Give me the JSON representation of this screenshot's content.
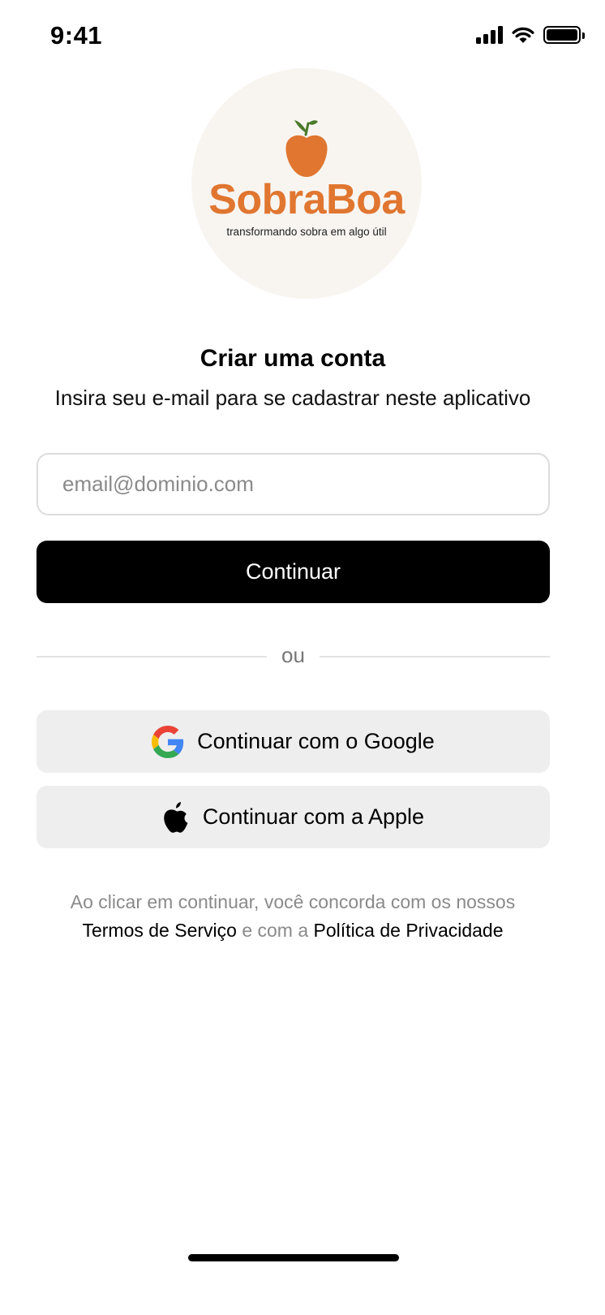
{
  "status_bar": {
    "time": "9:41",
    "icons": [
      "cellular-signal-icon",
      "wifi-icon",
      "battery-icon"
    ]
  },
  "logo": {
    "name": "SobraBoa",
    "tagline": "transformando sobra em algo útil",
    "icon": "apple-fruit-icon",
    "colors": {
      "brand": "#e07630",
      "leaf": "#4a7a2a",
      "background": "#f8f5f1"
    }
  },
  "header": {
    "title": "Criar uma conta",
    "subtitle": "Insira seu e-mail para se cadastrar neste aplicativo"
  },
  "form": {
    "email_placeholder": "email@dominio.com",
    "email_value": "",
    "continue_label": "Continuar"
  },
  "divider": {
    "text": "ou"
  },
  "social": {
    "google_label": "Continuar com o Google",
    "google_icon": "google-icon",
    "apple_label": "Continuar com a Apple",
    "apple_icon": "apple-icon"
  },
  "legal": {
    "prefix": "Ao clicar em continuar, você concorda com os nossos",
    "terms_label": "Termos de Serviço",
    "connector": "e com a",
    "privacy_label": "Política de Privacidade"
  },
  "colors": {
    "primary_button": "#000000",
    "social_button": "#eeeeee",
    "muted_text": "#8a8a8a"
  }
}
